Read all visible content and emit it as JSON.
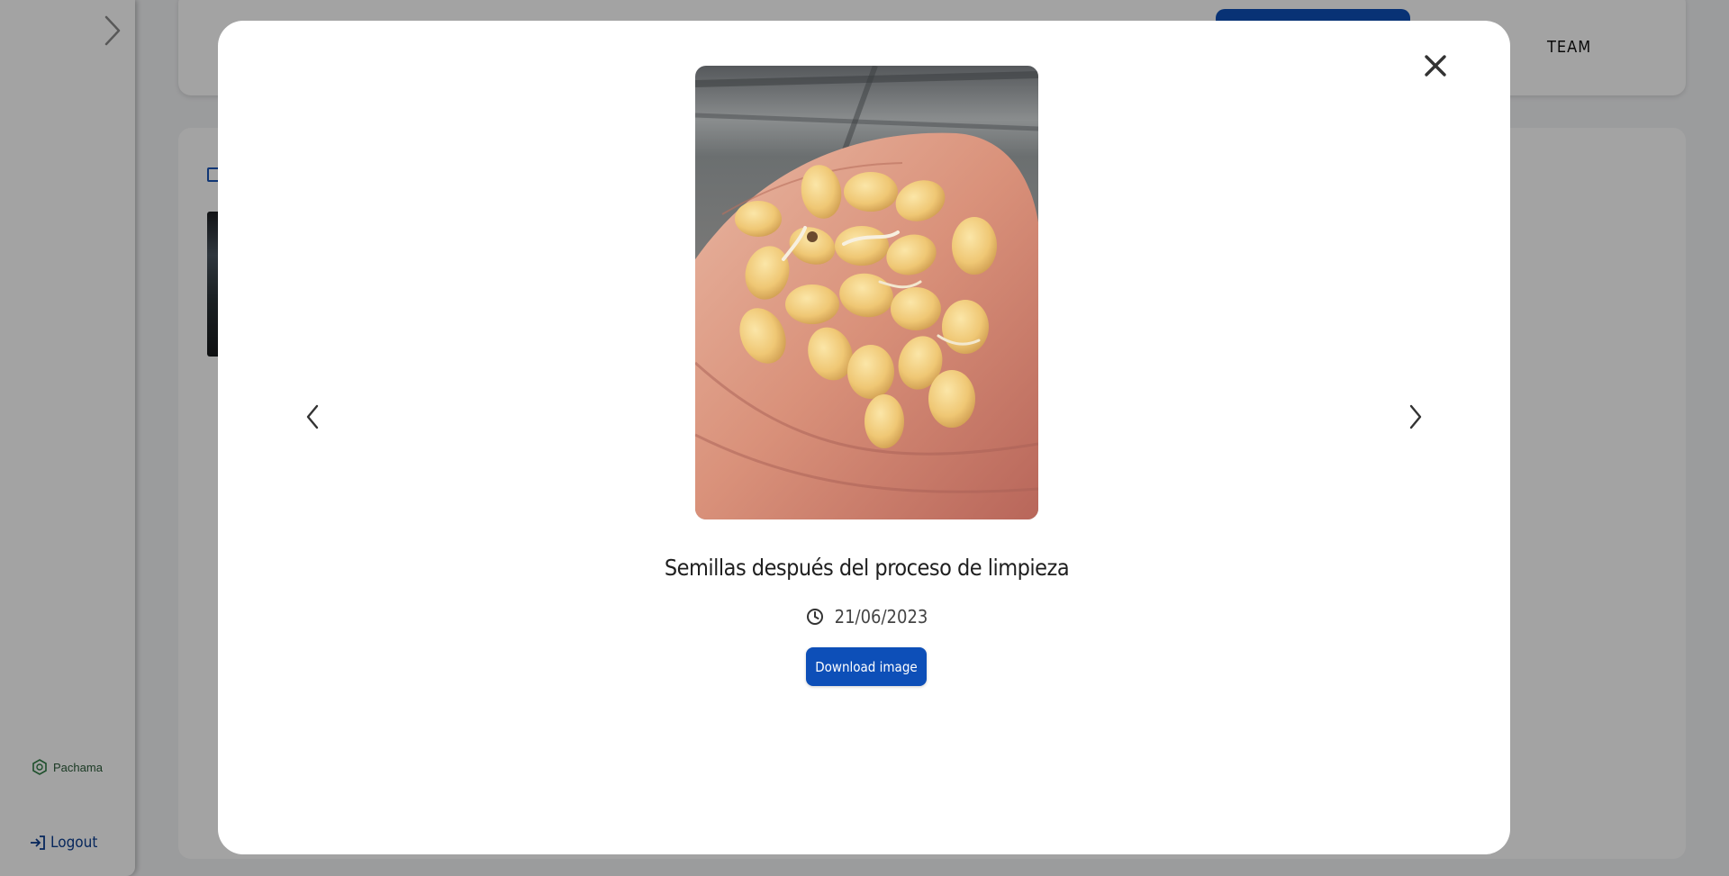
{
  "sidebar": {
    "brand_name": "Pachama",
    "logout_label": "Logout",
    "expand_icon": "chevron-right-icon"
  },
  "header": {
    "team_label": "TEAM",
    "primary_color": "#0d4fb8"
  },
  "modal": {
    "caption": "Semillas después del proceso de limpieza",
    "date": "21/06/2023",
    "download_label": "Download image",
    "icons": {
      "close": "close-icon",
      "previous": "chevron-left-icon",
      "next": "chevron-right-icon",
      "date": "clock-icon"
    }
  }
}
